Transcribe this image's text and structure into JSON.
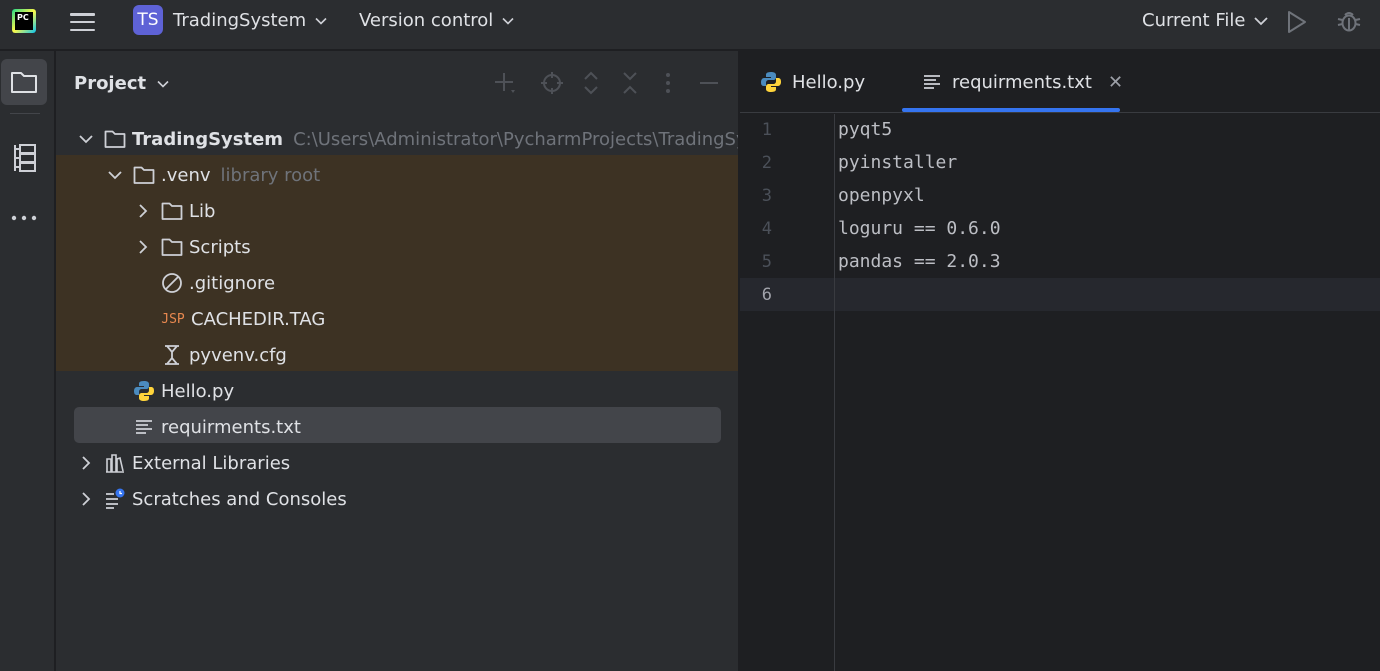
{
  "topbar": {
    "logo_text": "PC",
    "project_badge": "TS",
    "project_name": "TradingSystem",
    "version_control": "Version control",
    "run_config": "Current File"
  },
  "project_panel": {
    "title": "Project",
    "tree": [
      {
        "label": "TradingSystem",
        "hint": "C:\\Users\\Administrator\\PycharmProjects\\TradingSystem"
      },
      {
        "label": ".venv",
        "hint": "library root"
      },
      {
        "label": "Lib"
      },
      {
        "label": "Scripts"
      },
      {
        "label": ".gitignore"
      },
      {
        "label": "CACHEDIR.TAG",
        "icon_text": "JSP"
      },
      {
        "label": "pyvenv.cfg"
      },
      {
        "label": "Hello.py"
      },
      {
        "label": "requirments.txt"
      },
      {
        "label": "External Libraries"
      },
      {
        "label": "Scratches and Consoles"
      }
    ]
  },
  "editor": {
    "tabs": [
      {
        "label": "Hello.py",
        "icon": "python-icon"
      },
      {
        "label": "requirments.txt",
        "icon": "text-file-icon",
        "active": true
      }
    ],
    "line_numbers": [
      "1",
      "2",
      "3",
      "4",
      "5",
      "6"
    ],
    "current_line": 6,
    "lines": [
      "pyqt5",
      "pyinstaller",
      "openpyxl",
      "loguru == 0.6.0",
      "pandas == 2.0.3",
      ""
    ]
  },
  "colors": {
    "accent": "#3574f0",
    "project_badge": "#5e62d6",
    "venv_highlight": "#3d3223",
    "selection": "#43454a"
  }
}
